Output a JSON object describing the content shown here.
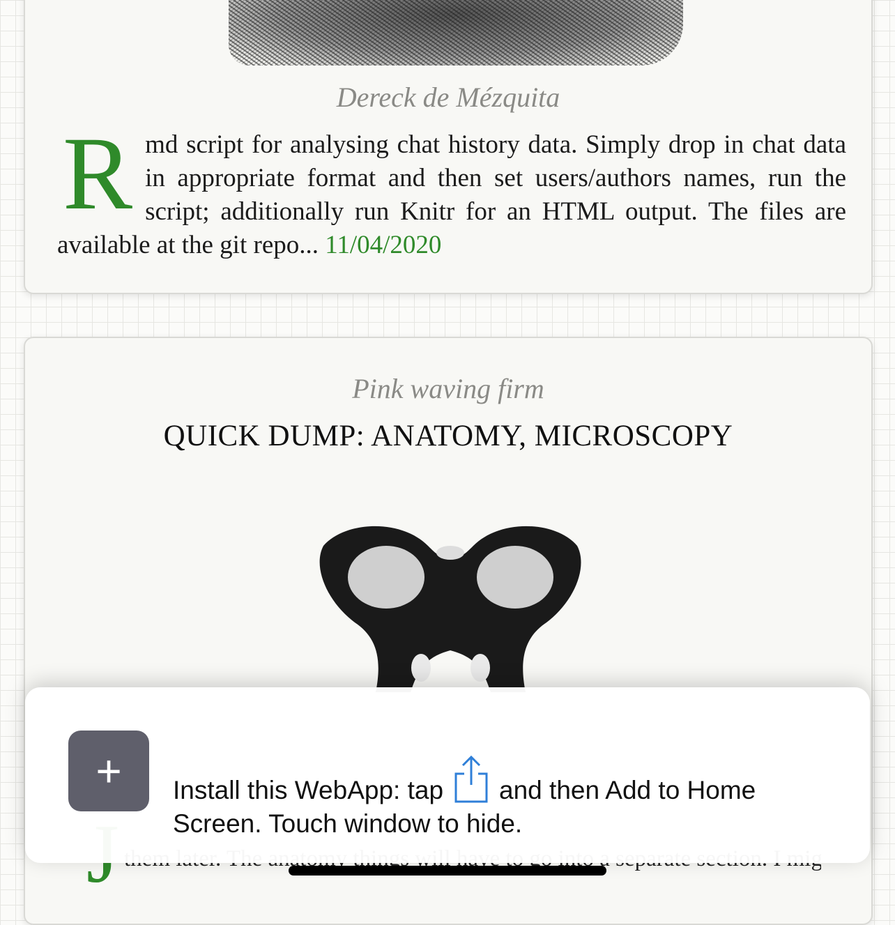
{
  "post1": {
    "author": "Dereck de Mézquita",
    "dropcap": "R",
    "excerpt": "md script for analysing chat history data. Simply drop in chat data in appropriate format and then set users/authors names, run the script; additionally run Knitr for an HTML output. The files are available at the git repo...",
    "date": "11/04/2020"
  },
  "post2": {
    "author": "Pink waving firm",
    "title": "QUICK DUMP: ANATOMY, MICROSCOPY",
    "dropcap": "J",
    "partial_text": "them later. The anatomy things will have to go into a separate section. I might annotate and comment the dissection images"
  },
  "install_banner": {
    "add_icon": "plus-icon",
    "share_icon": "share-icon",
    "text_before": "Install this WebApp: tap",
    "text_after": "and then Add to Home Screen. Touch window to hide."
  },
  "colors": {
    "accent_green": "#2f8a2a",
    "author_gray": "#8a8a86",
    "icon_bg": "#5f5f6b",
    "share_blue": "#2f7fd8"
  }
}
